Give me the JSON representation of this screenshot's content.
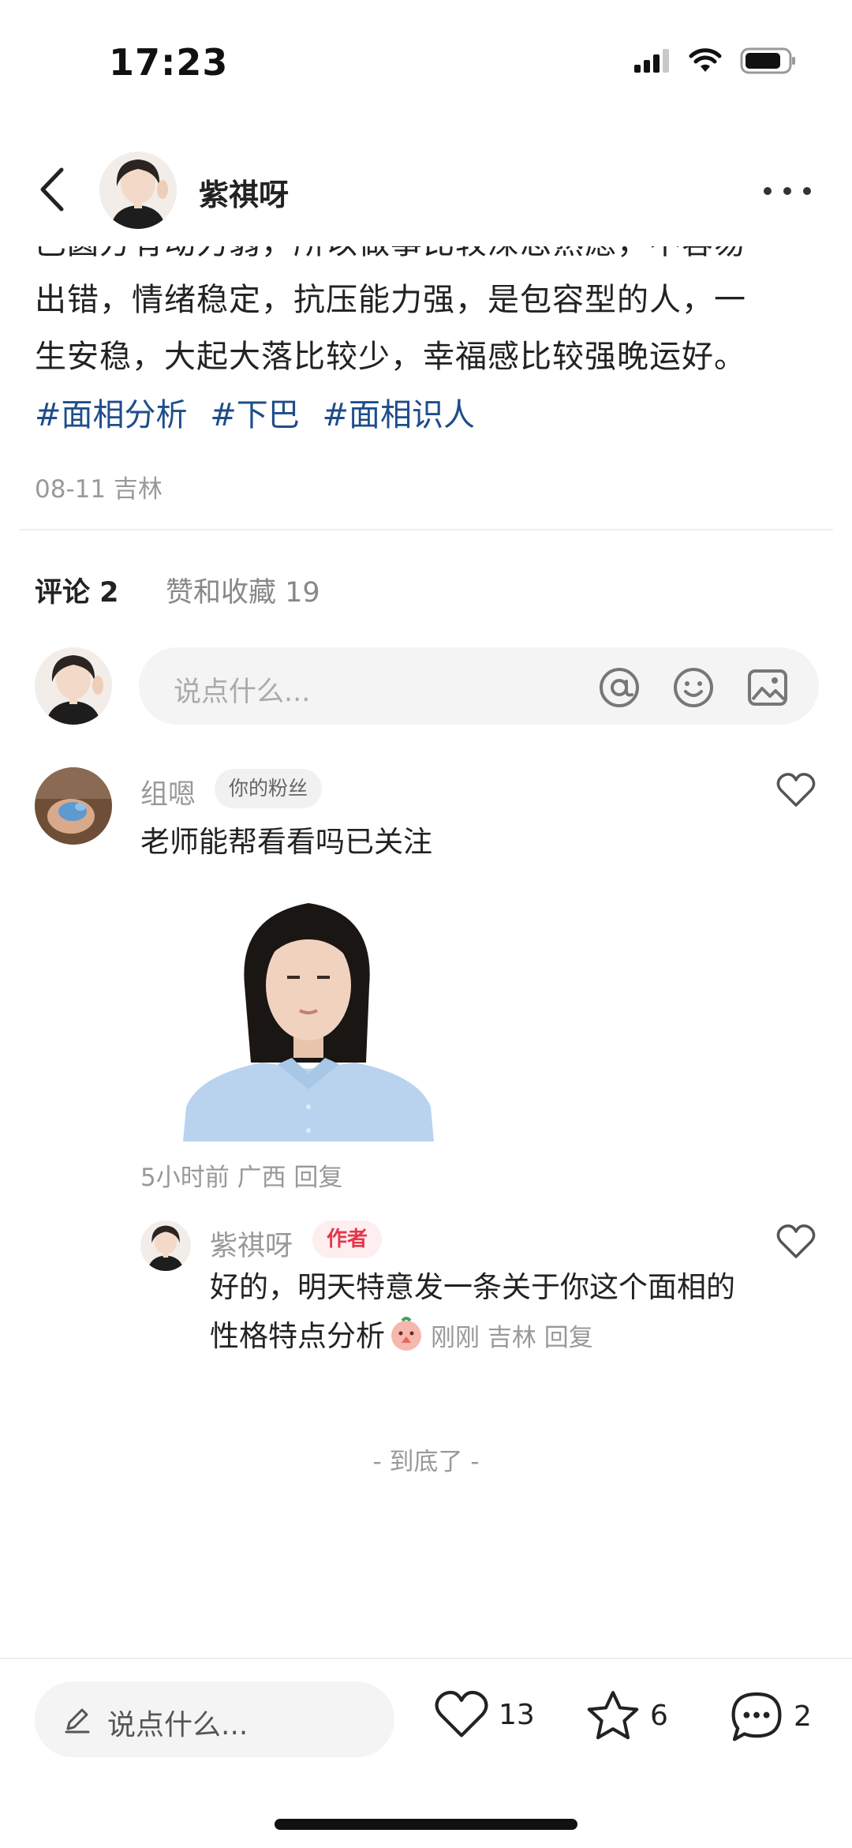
{
  "status_bar": {
    "time": "17:23"
  },
  "header": {
    "author_name": "紫祺呀"
  },
  "post": {
    "lines": [
      "巴圆方有动力弱，所以做事比较深思熟虑，不容易",
      "出错，情绪稳定，抗压能力强，是包容型的人，一",
      "生安稳，大起大落比较少，幸福感比较强晚运好。"
    ],
    "tags": [
      "#面相分析",
      "#下巴",
      "#面相识人"
    ],
    "meta": "08-11 吉林"
  },
  "tabs": {
    "comments": "评论 2",
    "likes": "赞和收藏 19"
  },
  "comment_input": {
    "placeholder": "说点什么..."
  },
  "comments": [
    {
      "name": "组嗯",
      "badge": "你的粉丝",
      "text": "老师能帮看看吗已关注",
      "meta": "5小时前 广西 回复",
      "reply": {
        "name": "紫祺呀",
        "badge": "作者",
        "text": "好的，明天特意发一条关于你这个面相的性格特点分析",
        "meta": "刚刚 吉林 回复"
      }
    }
  ],
  "end_text": "- 到底了 -",
  "bottom_bar": {
    "placeholder": "说点什么...",
    "likes": "13",
    "favorites": "6",
    "comments": "2"
  },
  "colors": {
    "tag": "#1e4d8a",
    "author_badge": "#e6354a",
    "muted": "#999999"
  },
  "icons": [
    "back-icon",
    "more-icon",
    "at-icon",
    "emoji-icon",
    "image-icon",
    "heart-icon",
    "star-icon",
    "comment-bubble-icon",
    "pencil-icon"
  ]
}
